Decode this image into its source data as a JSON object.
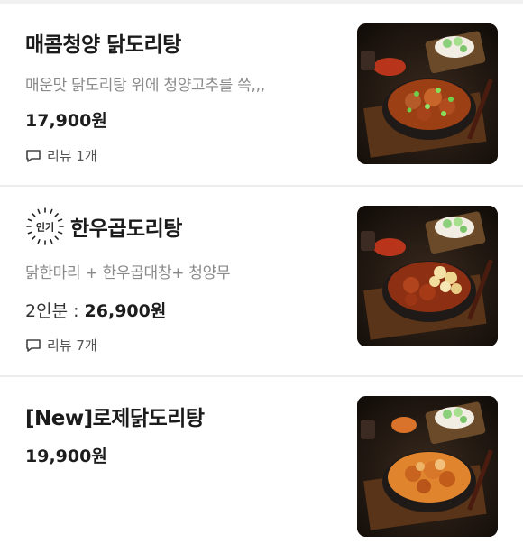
{
  "menu_items": [
    {
      "name": "매콤청양 닭도리탕",
      "description": "매운맛 닭도리탕 위에 청양고추를 쓱,,,",
      "price": "17,900원",
      "reviews": "리뷰 1개",
      "image": "spicy-chicken-stew-photo"
    },
    {
      "badge": "인기",
      "name": "한우곱도리탕",
      "description": "닭한마리 + 한우곱대창+ 청양무",
      "portion": "2인분 : ",
      "price": "26,900원",
      "reviews": "리뷰 7개",
      "image": "beef-intestine-chicken-stew-photo"
    },
    {
      "name": "[New]로제닭도리탕",
      "price": "19,900원",
      "image": "rose-chicken-stew-photo"
    }
  ],
  "colors": {
    "text_primary": "#1b1b1b",
    "text_secondary": "#8a8a8a",
    "divider": "#ececec"
  }
}
